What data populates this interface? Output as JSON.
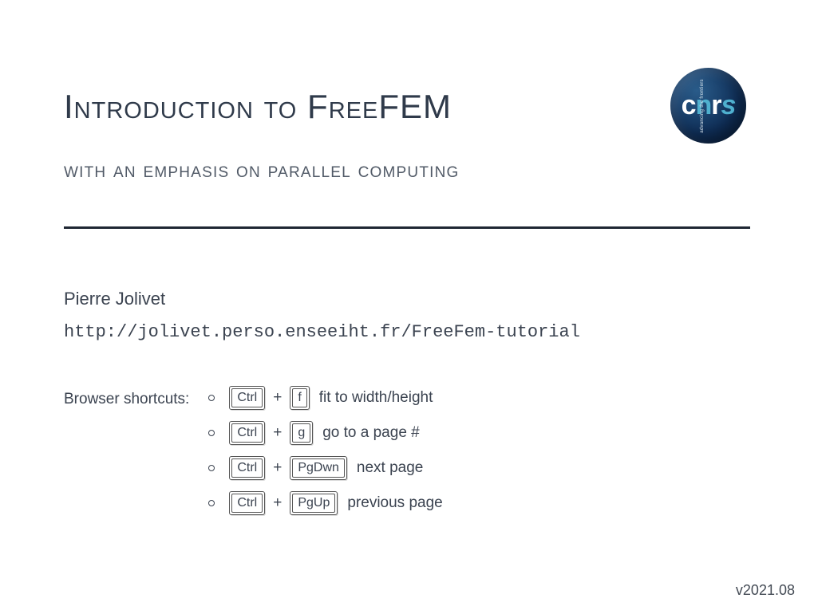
{
  "title_parts": {
    "word1_cap": "I",
    "word1_rest": "ntroduction",
    "word2": "to",
    "word3_cap": "F",
    "word3_rest": "ree",
    "word3_tail": "FEM"
  },
  "subtitle": "with an emphasis on parallel computing",
  "author": "Pierre Jolivet",
  "url": "http://jolivet.perso.enseeiht.fr/FreeFem-tutorial",
  "shortcuts_label": "Browser shortcuts:",
  "shortcuts": [
    {
      "keys": [
        "Ctrl",
        "f"
      ],
      "desc": "fit to width/height"
    },
    {
      "keys": [
        "Ctrl",
        "g"
      ],
      "desc": "go to a page #"
    },
    {
      "keys": [
        "Ctrl",
        "PgDwn"
      ],
      "desc": "next page"
    },
    {
      "keys": [
        "Ctrl",
        "PgUp"
      ],
      "desc": "previous page"
    }
  ],
  "plus": "+",
  "logo": {
    "text_c": "c",
    "text_n": "n",
    "text_r": "r",
    "text_s": "s",
    "side": "advancing the frontiers"
  },
  "version": "v2021.08"
}
